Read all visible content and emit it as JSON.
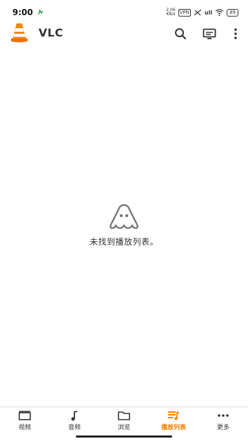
{
  "status_bar": {
    "time": "9:00",
    "speed_value": "2.06",
    "speed_unit": "KB/s",
    "vpn": "VPN",
    "signal": "ull",
    "battery": "89"
  },
  "app_bar": {
    "title": "VLC",
    "accent": "#f07c00"
  },
  "empty_state": {
    "message": "未找到播放列表。"
  },
  "bottom_nav": {
    "items": [
      {
        "label": "视频",
        "icon": "video-clapper-icon",
        "active": false
      },
      {
        "label": "音频",
        "icon": "music-note-icon",
        "active": false
      },
      {
        "label": "浏览",
        "icon": "folder-icon",
        "active": false
      },
      {
        "label": "播放列表",
        "icon": "playlist-icon",
        "active": true
      },
      {
        "label": "更多",
        "icon": "more-dots-icon",
        "active": false
      }
    ],
    "active_color": "#f07c00"
  }
}
